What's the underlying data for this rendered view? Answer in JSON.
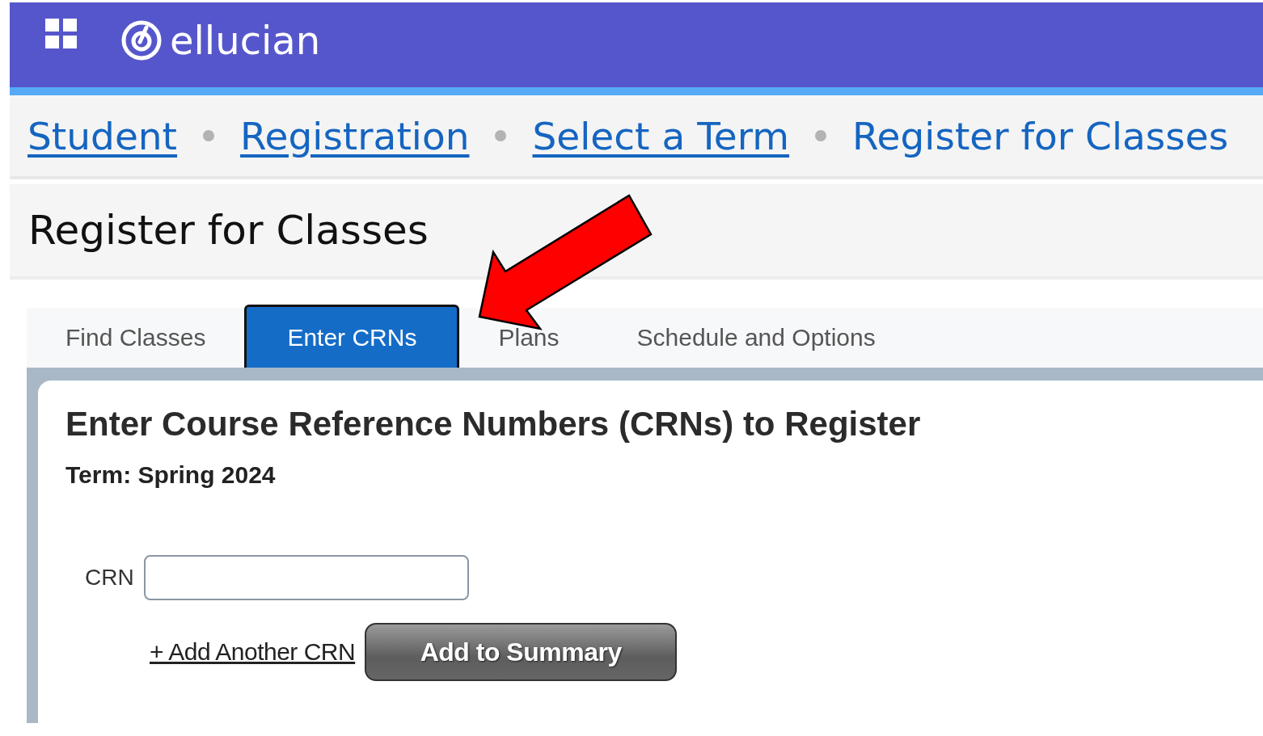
{
  "header": {
    "brand": "ellucian"
  },
  "breadcrumbs": [
    {
      "label": "Student",
      "current": false
    },
    {
      "label": "Registration",
      "current": false
    },
    {
      "label": "Select a Term",
      "current": false
    },
    {
      "label": "Register for Classes",
      "current": true
    }
  ],
  "page_title": "Register for Classes",
  "tabs": [
    {
      "label": "Find Classes",
      "selected": false
    },
    {
      "label": "Enter CRNs",
      "selected": true
    },
    {
      "label": "Plans",
      "selected": false
    },
    {
      "label": "Schedule and Options",
      "selected": false
    }
  ],
  "panel": {
    "heading": "Enter Course Reference Numbers (CRNs) to Register",
    "term": "Term: Spring 2024",
    "crn_label": "CRN",
    "add_link": "+ Add Another CRN",
    "submit_button": "Add to Summary"
  }
}
